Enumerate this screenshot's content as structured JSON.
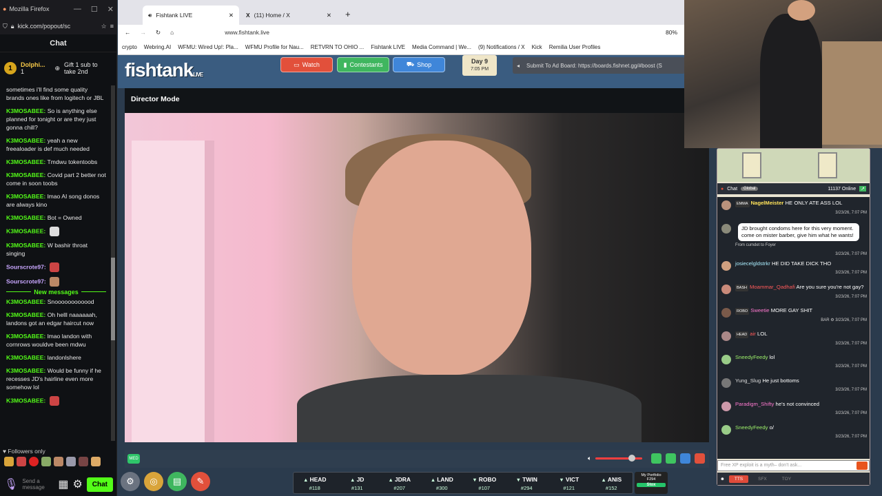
{
  "kick": {
    "window_title": "Mozilla Firefox",
    "url": "kick.com/popout/sc",
    "chat_title": "Chat",
    "pinned_user": "Dolphi...",
    "pinned_rank": "1",
    "pinned_count": "1",
    "gift_text": "Gift 1 sub to take 2nd",
    "messages": [
      {
        "user": "",
        "text": "sometimes i'll find some quality brands ones like from logitech or JBL"
      },
      {
        "user": "K3MOSABEE:",
        "text": "So is anything else planned for tonight or are they just gonna chill?"
      },
      {
        "user": "K3MOSABEE:",
        "text": "yeah a new freealoader is def much needed"
      },
      {
        "user": "K3MOSABEE:",
        "text": "Tmdwu tokentoobs"
      },
      {
        "user": "K3MOSABEE:",
        "text": "Covid part 2 better not come in soon toobs"
      },
      {
        "user": "K3MOSABEE:",
        "text": "lmao AI song donos are always kino"
      },
      {
        "user": "K3MOSABEE:",
        "text": "Bot = Owned"
      },
      {
        "user": "K3MOSABEE:",
        "text": ""
      },
      {
        "user": "K3MOSABEE:",
        "text": "W bashir throat singing"
      },
      {
        "user": "Sourscrote97:",
        "text": ""
      },
      {
        "user": "Sourscrote97:",
        "text": ""
      }
    ],
    "new_messages_label": "New messages",
    "messages_after": [
      {
        "user": "K3MOSABEE:",
        "text": "Snoooooooooood"
      },
      {
        "user": "K3MOSABEE:",
        "text": "Oh helll naaaaaah, landons got an edgar haircut now"
      },
      {
        "user": "K3MOSABEE:",
        "text": "lmao landon with cornrows wouldve been mdwu"
      },
      {
        "user": "K3MOSABEE:",
        "text": "landonlshere"
      },
      {
        "user": "K3MOSABEE:",
        "text": "Would be funny if he recesses JD's hairline even more somehow lol"
      },
      {
        "user": "K3MOSABEE:",
        "text": ""
      }
    ],
    "followers_only": "Followers only",
    "send_placeholder": "Send a message",
    "chat_button": "Chat"
  },
  "browser": {
    "tabs": [
      {
        "label": "Fishtank LIVE"
      },
      {
        "label": "(11) Home / X"
      }
    ],
    "url": "www.fishtank.live",
    "zoom": "80%",
    "bookmarks": [
      "crypto",
      "Webring.AI",
      "WFMU: Wired Up!: Pla...",
      "WFMU Profile for Nau...",
      "RETVRN TO OHIO ...",
      "Fishtank LIVE",
      "Media Command | We...",
      "(9) Notifications / X",
      "Kick",
      "Remilia User Profiles"
    ]
  },
  "fishtank": {
    "logo": "fishtank",
    "logo_suffix": "LIVE",
    "watch": "Watch",
    "contestants": "Contestants",
    "shop": "Shop",
    "day": "Day 9",
    "time": "7:05 PM",
    "adboard": "Submit To Ad Board: https://boards.fishnet.gg/#boost (S",
    "director_mode": "Director Mode",
    "quality": "MED",
    "contestants_bar": [
      {
        "name": "HEAD",
        "rank": "#118",
        "dir": "up"
      },
      {
        "name": "JD",
        "rank": "#131",
        "dir": "up"
      },
      {
        "name": "JDRA",
        "rank": "#207",
        "dir": "up"
      },
      {
        "name": "LAND",
        "rank": "#300",
        "dir": "up"
      },
      {
        "name": "ROBO",
        "rank": "#107",
        "dir": "dn"
      },
      {
        "name": "TWIN",
        "rank": "#294",
        "dir": "dn"
      },
      {
        "name": "VICT",
        "rank": "#121",
        "dir": "dn"
      },
      {
        "name": "ANIS",
        "rank": "#152",
        "dir": "up"
      }
    ],
    "portfolio_label": "My Portfolio",
    "portfolio_value": "F294",
    "stox": "Stox"
  },
  "ftchat": {
    "title": "Chat",
    "tab": "Global",
    "online": "11137 Online",
    "messages": [
      {
        "badge": "EMMA",
        "user": "NagelMeister",
        "text": "HE ONLY ATE ASS LOL",
        "ts": "3/23/26, 7:07 PM",
        "ucls": "u1"
      },
      {
        "badge": "",
        "user": "",
        "text": "JD brought condoms here for this very moment. come on mister barber, give him what he wants!",
        "ts": "3/23/26, 7:07 PM",
        "from": "From cumdet to Foyer",
        "bubble": true,
        "ucls": "u6"
      },
      {
        "badge": "",
        "user": "josiecelgldstrkr",
        "text": "HE DID TAKE DICK THO",
        "ts": "3/23/26, 7:07 PM",
        "ucls": "u2"
      },
      {
        "badge": "BASH",
        "user": "Moammar_Qadhafi",
        "text": "Are you sure you're not gay?",
        "ts": "3/23/26, 7:07 PM",
        "ucls": "u3"
      },
      {
        "badge": "ROBO",
        "user": "Sweetie",
        "text": "MORE GAY SHIT",
        "ts": "BAR ⚙ 3/23/26, 7:07 PM",
        "ucls": "u5"
      },
      {
        "badge": "HEAD",
        "user": "air",
        "text": "LOL",
        "ts": "3/23/26, 7:07 PM",
        "ucls": "u3"
      },
      {
        "badge": "",
        "user": "SneedyFeedy",
        "text": "lol",
        "ts": "3/23/26, 7:07 PM",
        "ucls": "u4"
      },
      {
        "badge": "",
        "user": "Yung_Slug",
        "text": "He just bottoms",
        "ts": "3/23/26, 7:07 PM",
        "ucls": "u6"
      },
      {
        "badge": "",
        "user": "Paradigm_Shifty",
        "text": "he's not convinced",
        "ts": "3/23/26, 7:07 PM",
        "ucls": "u5"
      },
      {
        "badge": "",
        "user": "SneedyFeedy",
        "text": "o/",
        "ts": "3/23/26, 7:07 PM",
        "ucls": "u4"
      }
    ],
    "input_placeholder": "Free XP exploit is a myth– don't ask...",
    "tts": "TTS",
    "sfx": "SFX",
    "toy": "TOY"
  }
}
